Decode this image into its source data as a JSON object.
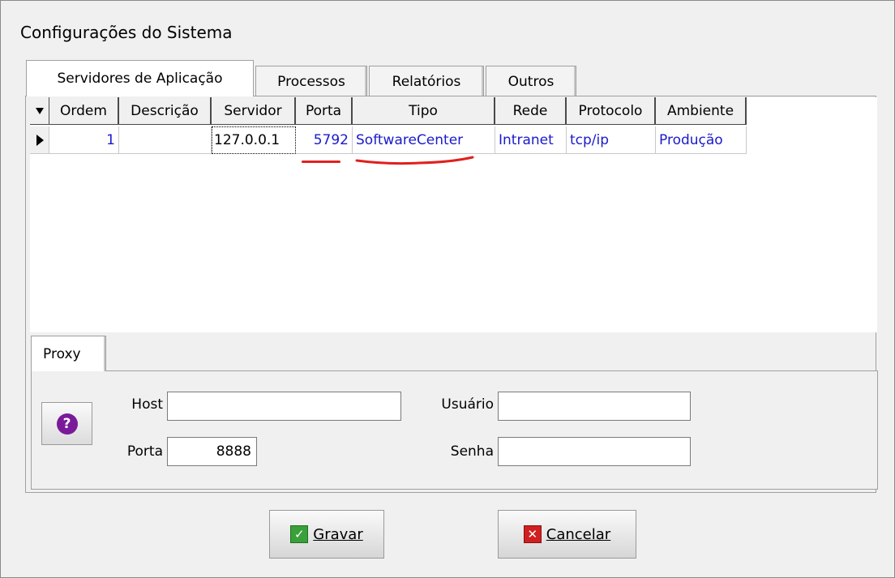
{
  "window": {
    "title": "Configurações do Sistema"
  },
  "tabs": [
    {
      "label": "Servidores de Aplicação",
      "active": true
    },
    {
      "label": "Processos",
      "active": false
    },
    {
      "label": "Relatórios",
      "active": false
    },
    {
      "label": "Outros",
      "active": false
    }
  ],
  "grid": {
    "columns": [
      "Ordem",
      "Descrição",
      "Servidor",
      "Porta",
      "Tipo",
      "Rede",
      "Protocolo",
      "Ambiente"
    ],
    "rows": [
      {
        "ordem": "1",
        "descricao": "",
        "servidor": "127.0.0.1",
        "porta": "5792",
        "tipo": "SoftwareCenter",
        "rede": "Intranet",
        "protocolo": "tcp/ip",
        "ambiente": "Produção"
      }
    ]
  },
  "proxy": {
    "tab_label": "Proxy",
    "host_label": "Host",
    "host_value": "",
    "porta_label": "Porta",
    "porta_value": "8888",
    "usuario_label": "Usuário",
    "usuario_value": "",
    "senha_label": "Senha",
    "senha_value": ""
  },
  "buttons": {
    "gravar_label": "Gravar",
    "cancelar_label": "Cancelar"
  },
  "colors": {
    "link_blue": "#1a1acc",
    "annotation_red": "#e0201e",
    "help_purple": "#7a1a9a",
    "ok_green": "#3aa03a",
    "cancel_red": "#d02020"
  }
}
